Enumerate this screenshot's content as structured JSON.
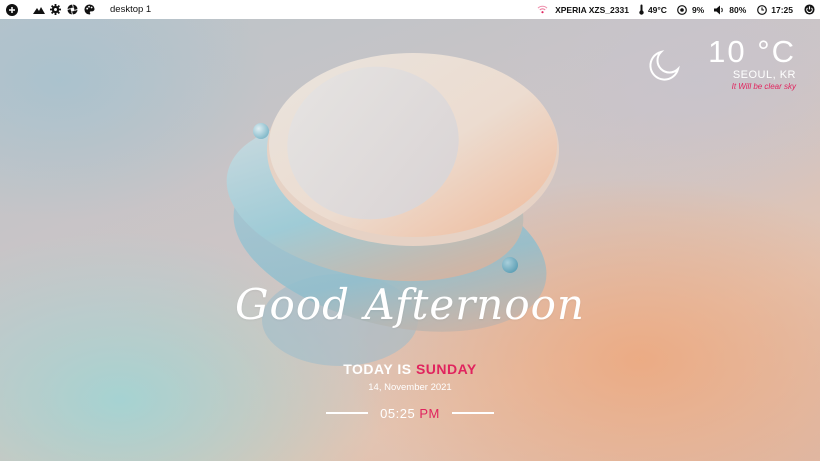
{
  "topbar": {
    "left": {
      "add_icon": "plus-circle-icon",
      "icons": [
        "mountain-icon",
        "gear-icon",
        "aperture-icon",
        "palette-icon"
      ],
      "desktop_label": "desktop 1"
    },
    "right": {
      "device": "XPERIA XZS_2331",
      "temperature": "49°C",
      "cpu": "9%",
      "volume": "80%",
      "clock": "17:25"
    }
  },
  "weather": {
    "temperature": "10 °C",
    "city": "SEOUL, KR",
    "forecast": "It Will be clear sky",
    "icon": "crescent-moon-icon"
  },
  "greeting": {
    "text": "Good Afternoon",
    "today_prefix": "TODAY IS",
    "day": "SUNDAY",
    "date": "14, November 2021",
    "time": "05:25",
    "meridiem": "PM"
  },
  "colors": {
    "accent": "#e0245e",
    "topbar_bg": "#ffffff",
    "text_light": "#ffffff"
  }
}
